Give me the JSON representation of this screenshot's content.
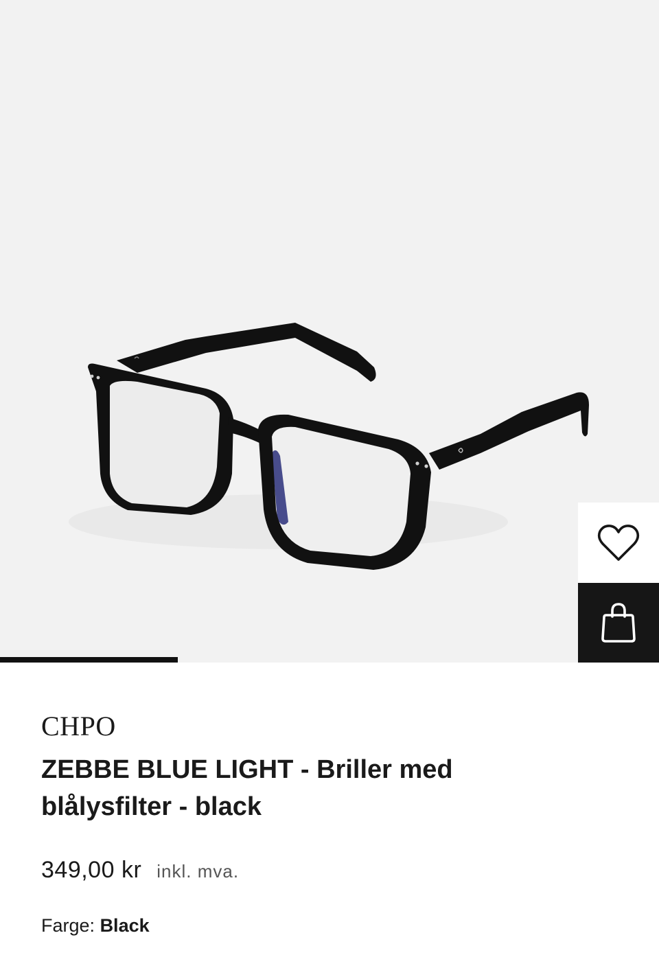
{
  "product": {
    "brand": "CHPO",
    "title": "ZEBBE BLUE LIGHT - Briller med blålysfilter - black",
    "price": "349,00 kr",
    "vat_note": "inkl. mva.",
    "color_label": "Farge:",
    "color_value": "Black"
  },
  "gallery": {
    "image_progress": 0.27
  },
  "actions": {
    "wishlist_icon": "heart-icon",
    "bag_icon": "shopping-bag-icon"
  },
  "colors": {
    "gallery_bg": "#f2f2f2",
    "frame": "#111111",
    "bag_button_bg": "#161616"
  }
}
